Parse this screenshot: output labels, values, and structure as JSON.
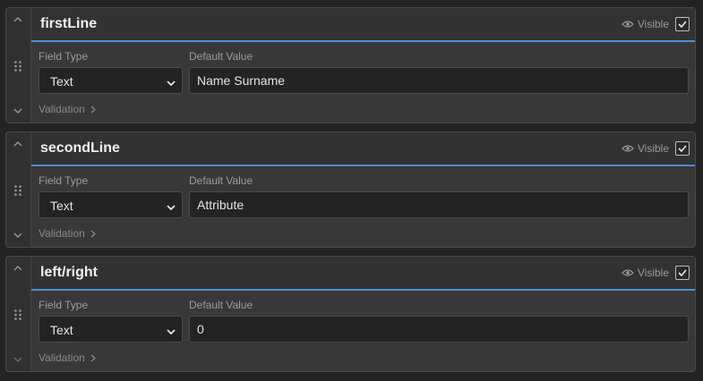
{
  "fields": [
    {
      "name": "firstLine",
      "visible_label": "Visible",
      "visible_checked": true,
      "field_type_label": "Field Type",
      "field_type_value": "Text",
      "default_value_label": "Default Value",
      "default_value": "Name Surname",
      "validation_label": "Validation"
    },
    {
      "name": "secondLine",
      "visible_label": "Visible",
      "visible_checked": true,
      "field_type_label": "Field Type",
      "field_type_value": "Text",
      "default_value_label": "Default Value",
      "default_value": "Attribute",
      "validation_label": "Validation"
    },
    {
      "name": "left/right",
      "visible_label": "Visible",
      "visible_checked": true,
      "field_type_label": "Field Type",
      "field_type_value": "Text",
      "default_value_label": "Default Value",
      "default_value": "0",
      "validation_label": "Validation"
    }
  ],
  "colors": {
    "background": "#232323",
    "card": "#383838",
    "accent": "#4d8fcf",
    "text": "#e4e4e4",
    "muted_text": "#9c9c9c"
  },
  "icons": [
    "chevron-up-icon",
    "drag-handle-icon",
    "chevron-down-icon",
    "eye-icon",
    "checkmark-icon",
    "chevron-right-icon"
  ]
}
